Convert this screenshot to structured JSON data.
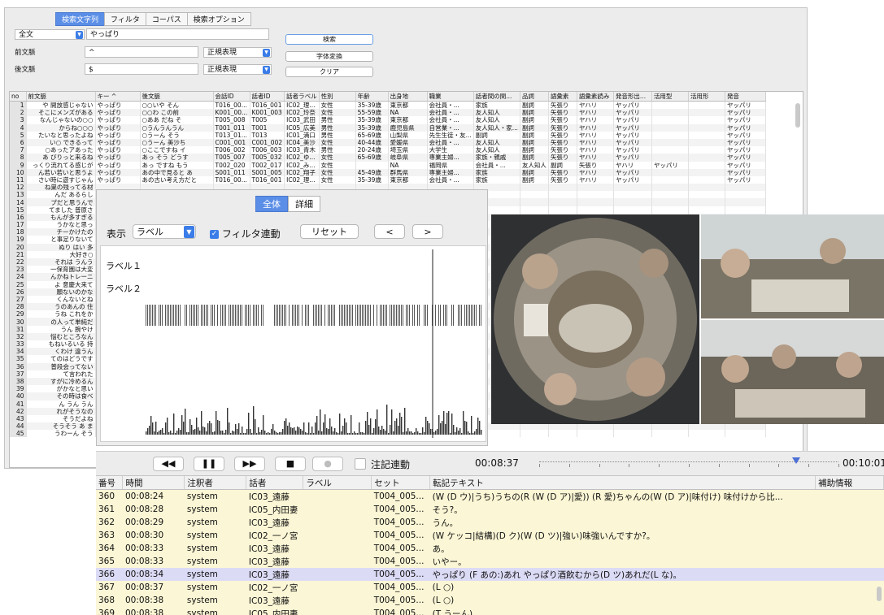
{
  "search": {
    "tabs": [
      "検索文字列",
      "フィルタ",
      "コーパス",
      "検索オプション"
    ],
    "active_tab": 0,
    "mode_value": "全文",
    "query_value": "やっぱり",
    "prev_label": "前文脈",
    "prev_value": "^",
    "prev_type": "正規表現",
    "next_label": "後文脈",
    "next_value": "$",
    "next_type": "正規表現",
    "search_button": "検索",
    "convert_button": "字体変換",
    "clear_button": "クリア"
  },
  "results": {
    "columns": [
      "no",
      "前文脈",
      "キー ^",
      "後文脈",
      "会話ID",
      "話者ID",
      "話者ラベル",
      "性別",
      "年齢",
      "出身地",
      "職業",
      "話者間の関...",
      "品詞",
      "語彙素",
      "語彙素読み",
      "発音形出...",
      "活用型",
      "活用形",
      "発音"
    ],
    "rows": [
      [
        "1",
        "や 開放感じゃない",
        "やっぱり",
        "○○いや そん",
        "T016_00...",
        "T016_001",
        "IC02_理...",
        "女性",
        "35-39歳",
        "東京都",
        "会社員・...",
        "家族",
        "副詞",
        "矢張り",
        "ヤハリ",
        "ヤッパリ",
        "",
        "",
        "ヤッパリ"
      ],
      [
        "2",
        "そこにメンズがある",
        "やっぱり",
        "○○わ この前",
        "K001_00...",
        "K001_003",
        "IC02_玲奈",
        "女性",
        "55-59歳",
        "NA",
        "会社員・...",
        "友人知人",
        "副詞",
        "矢張り",
        "ヤハリ",
        "ヤッパリ",
        "",
        "",
        "ヤッパリ"
      ],
      [
        "3",
        "なんじゃないの○○",
        "やっぱり",
        "○ああ だね そ",
        "T005_008",
        "T005",
        "IC03_武田",
        "男性",
        "35-39歳",
        "東京都",
        "会社員・...",
        "友人知人",
        "副詞",
        "矢張り",
        "ヤハリ",
        "ヤッパリ",
        "",
        "",
        "ヤッパリ"
      ],
      [
        "4",
        "からね○○○",
        "やっぱり",
        "○うんうんうん",
        "T001_011",
        "T001",
        "IC05_広美",
        "男性",
        "35-39歳",
        "鹿児島県",
        "自営業・...",
        "友人知人・家...",
        "副詞",
        "矢張り",
        "ヤハリ",
        "ヤッパリ",
        "",
        "",
        "ヤッパリ"
      ],
      [
        "5",
        "たいなと思ったよね",
        "やっぱり",
        "○うーん そう",
        "T013_01...",
        "T013",
        "IC01_満口",
        "男性",
        "65-69歳",
        "山梨県",
        "先生生徒・友...",
        "副詞",
        "副詞",
        "矢張り",
        "ヤハリ",
        "ヤッパリ",
        "",
        "",
        "ヤッパリ"
      ],
      [
        "6",
        "い○ できるって",
        "やっぱり",
        "○うーん 美沙ち",
        "C001_001",
        "C001_002",
        "IC04_美沙",
        "女性",
        "40-44歳",
        "愛媛県",
        "会社員・...",
        "友人知人",
        "副詞",
        "矢張り",
        "ヤハリ",
        "ヤッパリ",
        "",
        "",
        "ヤッパリ"
      ],
      [
        "7",
        "○あったアあった",
        "やっぱり",
        "○ここですね イ",
        "T006_002",
        "T006_003",
        "IC03_青木",
        "男性",
        "20-24歳",
        "埼玉県",
        "大学生",
        "友人知人",
        "副詞",
        "矢張り",
        "ヤハリ",
        "ヤッパリ",
        "",
        "",
        "ヤッパリ"
      ],
      [
        "8",
        "あ びりっと来るね",
        "やっぱり",
        "あっ そう どうす",
        "T005_007",
        "T005_032",
        "IC02_ゆ...",
        "女性",
        "65-69歳",
        "岐阜県",
        "専業主婦...",
        "家族・親戚",
        "副詞",
        "矢張り",
        "ヤハリ",
        "ヤッパリ",
        "",
        "",
        "ヤッパリ"
      ],
      [
        "9",
        "っくり流れてる感じが",
        "やっぱり",
        "あっ ですね もう",
        "T002_020",
        "T002_017",
        "IC02_み...",
        "女性",
        "",
        "NA",
        "福岡県",
        "会社員・...",
        "友人知人",
        "副詞",
        "矢張り",
        "ヤハリ",
        "ヤッパリ",
        "",
        "ヤッパリ"
      ],
      [
        "10",
        "ん若い若いと思うよ",
        "やっぱり",
        "あの中で見ると あ",
        "S001_011",
        "S001_005",
        "IC02_翔子",
        "女性",
        "45-49歳",
        "群馬県",
        "専業主婦...",
        "家族",
        "副詞",
        "矢張り",
        "ヤハリ",
        "ヤッパリ",
        "",
        "",
        "ヤッパリ"
      ],
      [
        "11",
        "さい時に遊すじゃん",
        "やっぱり",
        "あの古い考え方だと",
        "T016_00...",
        "T016_001",
        "IC02_理...",
        "女性",
        "35-39歳",
        "東京都",
        "会社員・...",
        "家族",
        "副詞",
        "矢張り",
        "ヤハリ",
        "ヤッパリ",
        "",
        "",
        "ヤッパリ"
      ],
      [
        "12",
        "ね巣の残ってる材",
        "",
        "",
        "",
        "",
        "",
        "",
        "",
        "",
        "",
        "",
        "",
        "",
        "",
        "",
        "",
        "",
        ""
      ],
      [
        "13",
        "んだ あるらし",
        "",
        "",
        "",
        "",
        "",
        "",
        "",
        "",
        "",
        "",
        "",
        "",
        "",
        "",
        "",
        "",
        ""
      ],
      [
        "14",
        "プだと思うんで",
        "",
        "",
        "",
        "",
        "",
        "",
        "",
        "",
        "",
        "",
        "",
        "",
        "",
        "",
        "",
        "",
        ""
      ],
      [
        "15",
        "てました 普原さ",
        "",
        "",
        "",
        "",
        "",
        "",
        "",
        "",
        "",
        "",
        "",
        "",
        "",
        "",
        "",
        "",
        ""
      ],
      [
        "16",
        "もんが多すぎる",
        "",
        "",
        "",
        "",
        "",
        "",
        "",
        "",
        "",
        "",
        "",
        "",
        "",
        "",
        "",
        "",
        ""
      ],
      [
        "17",
        "うかなと思っ",
        "",
        "",
        "",
        "",
        "",
        "",
        "",
        "",
        "",
        "",
        "",
        "",
        "",
        "",
        "",
        "",
        ""
      ],
      [
        "18",
        "チーかけたの",
        "",
        "",
        "",
        "",
        "",
        "",
        "",
        "",
        "",
        "",
        "",
        "",
        "",
        "",
        "",
        "",
        ""
      ],
      [
        "19",
        "と事足りないて",
        "",
        "",
        "",
        "",
        "",
        "",
        "",
        "",
        "",
        "",
        "",
        "",
        "",
        "",
        "",
        "",
        ""
      ],
      [
        "20",
        "ぬり はい 多",
        "",
        "",
        "",
        "",
        "",
        "",
        "",
        "",
        "",
        "",
        "",
        "",
        "",
        "",
        "",
        "",
        ""
      ],
      [
        "21",
        "大好き○",
        "",
        "",
        "",
        "",
        "",
        "",
        "",
        "",
        "",
        "",
        "",
        "",
        "",
        "",
        "",
        "",
        ""
      ],
      [
        "22",
        "それは うんう",
        "",
        "",
        "",
        "",
        "",
        "",
        "",
        "",
        "",
        "",
        "",
        "",
        "",
        "",
        "",
        "",
        ""
      ],
      [
        "23",
        "一保育園は大変",
        "",
        "",
        "",
        "",
        "",
        "",
        "",
        "",
        "",
        "",
        "",
        "",
        "",
        "",
        "",
        "",
        ""
      ],
      [
        "24",
        "んかねトレーニ",
        "",
        "",
        "",
        "",
        "",
        "",
        "",
        "",
        "",
        "",
        "",
        "",
        "",
        "",
        "",
        "",
        ""
      ],
      [
        "25",
        "よ 意慶大来て",
        "",
        "",
        "",
        "",
        "",
        "",
        "",
        "",
        "",
        "",
        "",
        "",
        "",
        "",
        "",
        "",
        ""
      ],
      [
        "26",
        "願ないのかな",
        "",
        "",
        "",
        "",
        "",
        "",
        "",
        "",
        "",
        "",
        "",
        "",
        "",
        "",
        "",
        "",
        ""
      ],
      [
        "27",
        "くんないとね",
        "",
        "",
        "",
        "",
        "",
        "",
        "",
        "",
        "",
        "",
        "",
        "",
        "",
        "",
        "",
        "",
        ""
      ],
      [
        "28",
        "うのあんの 住",
        "",
        "",
        "",
        "",
        "",
        "",
        "",
        "",
        "",
        "",
        "",
        "",
        "",
        "",
        "",
        "",
        ""
      ],
      [
        "29",
        "うね これをか",
        "",
        "",
        "",
        "",
        "",
        "",
        "",
        "",
        "",
        "",
        "",
        "",
        "",
        "",
        "",
        "",
        ""
      ],
      [
        "30",
        "の人って単純だ",
        "",
        "",
        "",
        "",
        "",
        "",
        "",
        "",
        "",
        "",
        "",
        "",
        "",
        "",
        "",
        "",
        ""
      ],
      [
        "31",
        "うん 腕やけ",
        "",
        "",
        "",
        "",
        "",
        "",
        "",
        "",
        "",
        "",
        "",
        "",
        "",
        "",
        "",
        "",
        ""
      ],
      [
        "32",
        "悩むところなん",
        "",
        "",
        "",
        "",
        "",
        "",
        "",
        "",
        "",
        "",
        "",
        "",
        "",
        "",
        "",
        "",
        ""
      ],
      [
        "33",
        "もねいるいる 持",
        "",
        "",
        "",
        "",
        "",
        "",
        "",
        "",
        "",
        "",
        "",
        "",
        "",
        "",
        "",
        "",
        ""
      ],
      [
        "34",
        "くわけ 違うん",
        "",
        "",
        "",
        "",
        "",
        "",
        "",
        "",
        "",
        "",
        "",
        "",
        "",
        "",
        "",
        "",
        ""
      ],
      [
        "35",
        "てのはどうです",
        "",
        "",
        "",
        "",
        "",
        "",
        "",
        "",
        "",
        "",
        "",
        "",
        "",
        "",
        "",
        "",
        ""
      ],
      [
        "36",
        "普段会ってない",
        "",
        "",
        "",
        "",
        "",
        "",
        "",
        "",
        "",
        "",
        "",
        "",
        "",
        "",
        "",
        "",
        ""
      ],
      [
        "37",
        "て言われた",
        "",
        "",
        "",
        "",
        "",
        "",
        "",
        "",
        "",
        "",
        "",
        "",
        "",
        "",
        "",
        "",
        ""
      ],
      [
        "38",
        "すがに冷めるん",
        "",
        "",
        "",
        "",
        "",
        "",
        "",
        "",
        "",
        "",
        "",
        "",
        "",
        "",
        "",
        "",
        ""
      ],
      [
        "39",
        "がかなと思い",
        "",
        "",
        "",
        "",
        "",
        "",
        "",
        "",
        "",
        "",
        "",
        "",
        "",
        "",
        "",
        "",
        ""
      ],
      [
        "40",
        "その時は食べ",
        "",
        "",
        "",
        "",
        "",
        "",
        "",
        "",
        "",
        "",
        "",
        "",
        "",
        "",
        "",
        "",
        ""
      ],
      [
        "41",
        "ん うん うん",
        "",
        "",
        "",
        "",
        "",
        "",
        "",
        "",
        "",
        "",
        "",
        "",
        "",
        "",
        "",
        "",
        ""
      ],
      [
        "42",
        "れがそうなの",
        "",
        "",
        "",
        "",
        "",
        "",
        "",
        "",
        "",
        "",
        "",
        "",
        "",
        "",
        "",
        "",
        ""
      ],
      [
        "43",
        "そうだよね",
        "",
        "",
        "",
        "",
        "",
        "",
        "",
        "",
        "",
        "",
        "",
        "",
        "",
        "",
        "",
        "",
        ""
      ],
      [
        "44",
        "そうそう あ ま",
        "",
        "",
        "",
        "",
        "",
        "",
        "",
        "",
        "",
        "",
        "",
        "",
        "",
        "",
        "",
        "",
        ""
      ],
      [
        "45",
        "うわーん そう",
        "",
        "",
        "",
        "",
        "",
        "",
        "",
        "",
        "",
        "",
        "",
        "",
        "",
        "",
        "",
        "",
        ""
      ]
    ]
  },
  "label_panel": {
    "tabs": [
      "全体",
      "詳細"
    ],
    "active_tab": 0,
    "display_label": "表示",
    "display_value": "ラベル",
    "filter_link_label": "フィルタ連動",
    "filter_link_checked": true,
    "reset_button": "リセット",
    "prev_button": "<",
    "next_button": ">",
    "label1": "ラベル１",
    "label2": "ラベル２"
  },
  "player": {
    "time": "00:08:37",
    "end_time": "00:10:01",
    "annotation_link_label": "注記連動",
    "position_fraction": 0.86
  },
  "transcript": {
    "columns": [
      "番号",
      "時間",
      "注釈者",
      "話者",
      "ラベル",
      "セット",
      "転記テキスト",
      "補助情報"
    ],
    "rows": [
      [
        "360",
        "00:08:24",
        "system",
        "IC03_遠藤",
        "",
        "T004_005...",
        "(W (D ウ)|うち)うちの(R (W (D ア)|愛)) (R 愛)ちゃんの(W (D ア)|味付け) 味付けから比...",
        ""
      ],
      [
        "361",
        "00:08:28",
        "system",
        "IC05_内田妻",
        "",
        "T004_005...",
        "そう?。",
        ""
      ],
      [
        "362",
        "00:08:29",
        "system",
        "IC03_遠藤",
        "",
        "T004_005...",
        "うん。",
        ""
      ],
      [
        "363",
        "00:08:30",
        "system",
        "IC02_一ノ宮",
        "",
        "T004_005...",
        "(W ケッコ|結構)(D ク)(W (D ツ)|強い)味強いんですか?。",
        ""
      ],
      [
        "364",
        "00:08:33",
        "system",
        "IC03_遠藤",
        "",
        "T004_005...",
        "あ。",
        ""
      ],
      [
        "365",
        "00:08:33",
        "system",
        "IC03_遠藤",
        "",
        "T004_005...",
        "いやー。",
        ""
      ],
      [
        "366",
        "00:08:34",
        "system",
        "IC03_遠藤",
        "",
        "T004_005...",
        "やっぱり (F あの:)あれ やっぱり酒飲むから(D ツ)あれだ(L な)。",
        ""
      ],
      [
        "367",
        "00:08:37",
        "system",
        "IC02_一ノ宮",
        "",
        "T004_005...",
        "(L ○)",
        ""
      ],
      [
        "368",
        "00:08:38",
        "system",
        "IC03_遠藤",
        "",
        "T004_005...",
        "(L ○)",
        ""
      ],
      [
        "369",
        "00:08:38",
        "system",
        "IC05_内田妻",
        "",
        "T004_005...",
        "(T うーん)。",
        ""
      ]
    ],
    "highlighted_row": 6
  },
  "colors": {
    "accent": "#5b8ee6",
    "row_yellow": "#fbf6d5",
    "row_highlight": "#dcdbf6"
  }
}
